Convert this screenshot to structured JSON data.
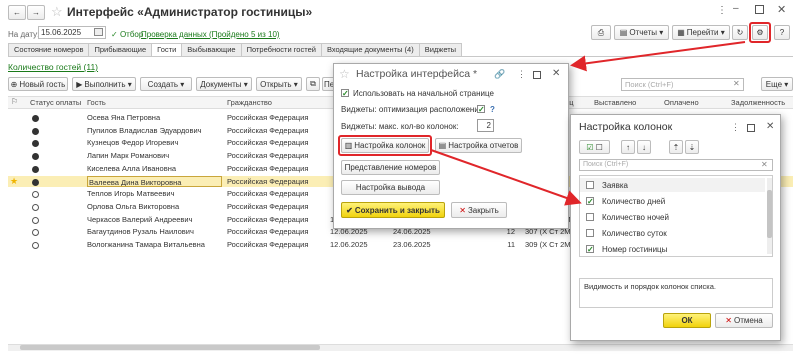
{
  "window": {
    "title": "Интерфейс «Администратор гостиницы»"
  },
  "toolbar1": {
    "date_label": "На дату:",
    "date_value": "15.06.2025",
    "filter_label": "Отбор",
    "check_link": "Проверка данных (Пройдено 5 из 10)",
    "reports": "Отчеты",
    "goto": "Перейти",
    "help": "?"
  },
  "tabs": [
    "Состояние номеров",
    "Прибывающие",
    "Гости",
    "Выбывающие",
    "Потребности гостей",
    "Входящие документы (4)",
    "Виджеты"
  ],
  "section_title": "Количество гостей (11)",
  "toolbar2": {
    "new_guest": "Новый гость",
    "execute": "Выполнить",
    "create": "Создать",
    "documents": "Документы",
    "open": "Открыть",
    "per": "Пер",
    "search_placeholder": "Поиск (Ctrl+F)",
    "more": "Еще"
  },
  "columns": [
    "Статус оплаты",
    "Гость",
    "Гражданство",
    "иц",
    "Выставлено",
    "Оплачено",
    "Задолженность"
  ],
  "rows": [
    {
      "guest": "Осева Яна Петровна",
      "citizenship": "Российская Федерация",
      "paid": true,
      "star": false,
      "sel": false,
      "d1": "",
      "d2": "",
      "n": "",
      "room": ""
    },
    {
      "guest": "Пупилов Владислав Эдуардович",
      "citizenship": "Российская Федерация",
      "paid": true,
      "star": false,
      "sel": false,
      "d1": "",
      "d2": "",
      "n": "",
      "room": ""
    },
    {
      "guest": "Кузнецов Федор Игоревич",
      "citizenship": "Российская Федерация",
      "paid": true,
      "star": false,
      "sel": false,
      "d1": "",
      "d2": "",
      "n": "",
      "room": ""
    },
    {
      "guest": "Лапин Марк Романович",
      "citizenship": "Российская Федерация",
      "paid": true,
      "star": false,
      "sel": false,
      "d1": "",
      "d2": "",
      "n": "",
      "room": ""
    },
    {
      "guest": "Киселева Алла Ивановна",
      "citizenship": "Российская Федерация",
      "paid": true,
      "star": false,
      "sel": false,
      "d1": "",
      "d2": "",
      "n": "",
      "room": ""
    },
    {
      "guest": "Валеева Дина Викторовна",
      "citizenship": "Российская Федерация",
      "paid": true,
      "star": true,
      "sel": true,
      "d1": "",
      "d2": "",
      "n": "",
      "room": ""
    },
    {
      "guest": "Теплов Игорь Матвеевич",
      "citizenship": "Российская Федерация",
      "paid": false,
      "star": false,
      "sel": false,
      "d1": "",
      "d2": "",
      "n": "",
      "room": ""
    },
    {
      "guest": "Орлова Ольга Викторовна",
      "citizenship": "Российская Федерация",
      "paid": false,
      "star": false,
      "sel": false,
      "d1": "",
      "d2": "",
      "n": "",
      "room": ""
    },
    {
      "guest": "Черкасов Валерий Андреевич",
      "citizenship": "Российская Федерация",
      "paid": false,
      "star": false,
      "sel": false,
      "d1": "11.06.2025",
      "d2": "23.06.2025",
      "n": "12",
      "room": "306 (Х Ст 2Мо"
    },
    {
      "guest": "Багаутдинов Рузаль Наилович",
      "citizenship": "Российская Федерация",
      "paid": false,
      "star": false,
      "sel": false,
      "d1": "12.06.2025",
      "d2": "24.06.2025",
      "n": "12",
      "room": "307 (Х Ст 2Мо"
    },
    {
      "guest": "Вологжанина Тамара Витальевна",
      "citizenship": "Российская Федерация",
      "paid": false,
      "star": false,
      "sel": false,
      "d1": "12.06.2025",
      "d2": "23.06.2025",
      "n": "11",
      "room": "309 (Х Ст 2Мо"
    }
  ],
  "dlg1": {
    "title": "Настройка интерфейса *",
    "use_on_start": "Использовать на начальной странице",
    "widgets_opt": "Виджеты: оптимизация расположения:",
    "widgets_max": "Виджеты: макс. кол-во колонок:",
    "widgets_max_value": "2",
    "col_settings": "Настройка колонок",
    "report_settings": "Настройка отчетов",
    "room_view": "Представление номеров",
    "output_settings": "Настройка вывода",
    "save_close": "Сохранить и закрыть",
    "close": "Закрыть"
  },
  "dlg2": {
    "title": "Настройка колонок",
    "search_placeholder": "Поиск (Ctrl+F)",
    "items": [
      {
        "label": "Заявка",
        "checked": false
      },
      {
        "label": "Количество дней",
        "checked": true
      },
      {
        "label": "Количество ночей",
        "checked": false
      },
      {
        "label": "Количество суток",
        "checked": false
      },
      {
        "label": "Номер гостиницы",
        "checked": true
      }
    ],
    "description": "Видимость и порядок колонок списка.",
    "ok": "ОК",
    "cancel": "Отмена"
  },
  "colors": {
    "accent_green": "#2a8a2a",
    "highlight": "#e0262a",
    "selection": "#fbeeb5",
    "link": "#1a7a1a"
  }
}
